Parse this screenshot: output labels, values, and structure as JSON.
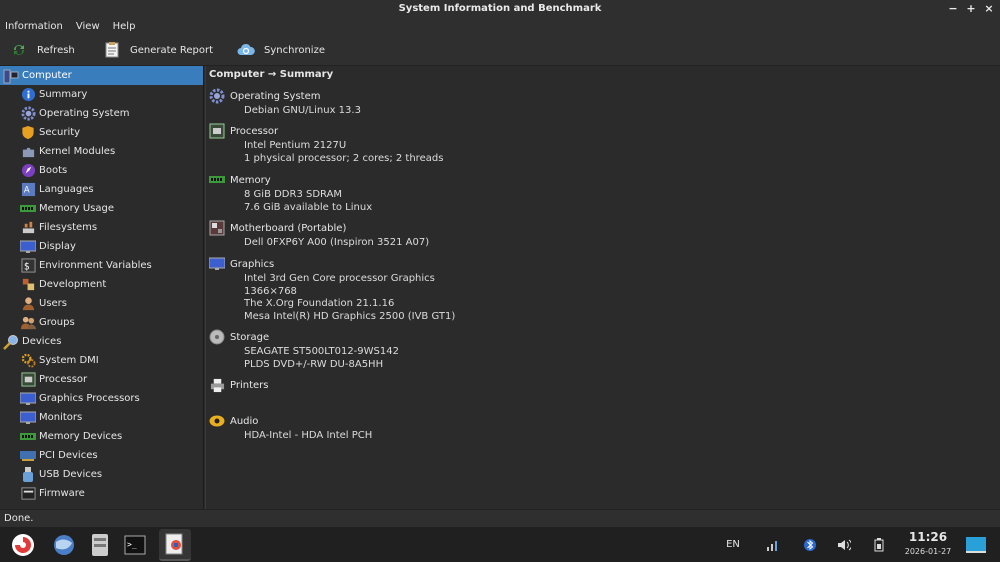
{
  "window": {
    "title": "System Information and Benchmark"
  },
  "menubar": {
    "items": [
      "Information",
      "View",
      "Help"
    ]
  },
  "toolbar": {
    "refresh_label": "Refresh",
    "report_label": "Generate Report",
    "sync_label": "Synchronize"
  },
  "sidebar": {
    "items": [
      {
        "label": "Computer",
        "icon": "computer-icon",
        "kind": "cat",
        "selected": true
      },
      {
        "label": "Summary",
        "icon": "info-icon",
        "kind": "sub"
      },
      {
        "label": "Operating System",
        "icon": "gear-icon",
        "kind": "sub"
      },
      {
        "label": "Security",
        "icon": "shield-icon",
        "kind": "sub"
      },
      {
        "label": "Kernel Modules",
        "icon": "puzzle-icon",
        "kind": "sub"
      },
      {
        "label": "Boots",
        "icon": "rocket-icon",
        "kind": "sub"
      },
      {
        "label": "Languages",
        "icon": "language-icon",
        "kind": "sub"
      },
      {
        "label": "Memory Usage",
        "icon": "memory-icon",
        "kind": "sub"
      },
      {
        "label": "Filesystems",
        "icon": "filesystem-icon",
        "kind": "sub"
      },
      {
        "label": "Display",
        "icon": "monitor-icon",
        "kind": "sub"
      },
      {
        "label": "Environment Variables",
        "icon": "terminal-icon",
        "kind": "sub"
      },
      {
        "label": "Development",
        "icon": "development-icon",
        "kind": "sub"
      },
      {
        "label": "Users",
        "icon": "user-icon",
        "kind": "sub"
      },
      {
        "label": "Groups",
        "icon": "group-icon",
        "kind": "sub"
      },
      {
        "label": "Devices",
        "icon": "magnifier-icon",
        "kind": "cat"
      },
      {
        "label": "System DMI",
        "icon": "gears-icon",
        "kind": "sub"
      },
      {
        "label": "Processor",
        "icon": "cpu-icon",
        "kind": "sub"
      },
      {
        "label": "Graphics Processors",
        "icon": "gpu-icon",
        "kind": "sub"
      },
      {
        "label": "Monitors",
        "icon": "monitor-icon",
        "kind": "sub"
      },
      {
        "label": "Memory Devices",
        "icon": "memory-icon",
        "kind": "sub"
      },
      {
        "label": "PCI Devices",
        "icon": "pci-icon",
        "kind": "sub"
      },
      {
        "label": "USB Devices",
        "icon": "usb-icon",
        "kind": "sub"
      },
      {
        "label": "Firmware",
        "icon": "firmware-icon",
        "kind": "sub"
      }
    ]
  },
  "main": {
    "breadcrumb": "Computer → Summary",
    "sections": [
      {
        "title": "Operating System",
        "icon": "gear-icon",
        "lines": [
          "Debian GNU/Linux 13.3"
        ]
      },
      {
        "title": "Processor",
        "icon": "cpu-icon",
        "lines": [
          "Intel Pentium 2127U",
          "1 physical processor; 2 cores; 2 threads"
        ]
      },
      {
        "title": "Memory",
        "icon": "memory-icon",
        "lines": [
          "8 GiB DDR3 SDRAM",
          "7.6 GiB available to Linux"
        ]
      },
      {
        "title": "Motherboard (Portable)",
        "icon": "motherboard-icon",
        "lines": [
          "Dell 0FXP6Y A00 (Inspiron 3521 A07)"
        ]
      },
      {
        "title": "Graphics",
        "icon": "monitor-icon",
        "lines": [
          "Intel 3rd Gen Core processor Graphics",
          "1366×768",
          "The X.Org Foundation 21.1.16",
          "Mesa Intel(R) HD Graphics 2500 (IVB GT1)"
        ]
      },
      {
        "title": "Storage",
        "icon": "disk-icon",
        "lines": [
          "SEAGATE ST500LT012-9WS142",
          "PLDS DVD+/-RW DU-8A5HH"
        ]
      },
      {
        "title": "Printers",
        "icon": "printer-icon",
        "lines": []
      },
      {
        "title": "Audio",
        "icon": "audio-icon",
        "lines": [
          "HDA-Intel - HDA Intel PCH"
        ]
      }
    ]
  },
  "statusbar": {
    "text": "Done."
  },
  "taskbar": {
    "apps": [
      "app-launcher-icon",
      "browser-icon",
      "file-manager-icon",
      "terminal-icon",
      "sysinfo-icon"
    ],
    "keyboard_layout": "EN",
    "time": "11:26",
    "date": "2026-01-27"
  },
  "colors": {
    "accent": "#3a7dbd",
    "background": "#2b2b2b",
    "taskbar": "#202020"
  }
}
